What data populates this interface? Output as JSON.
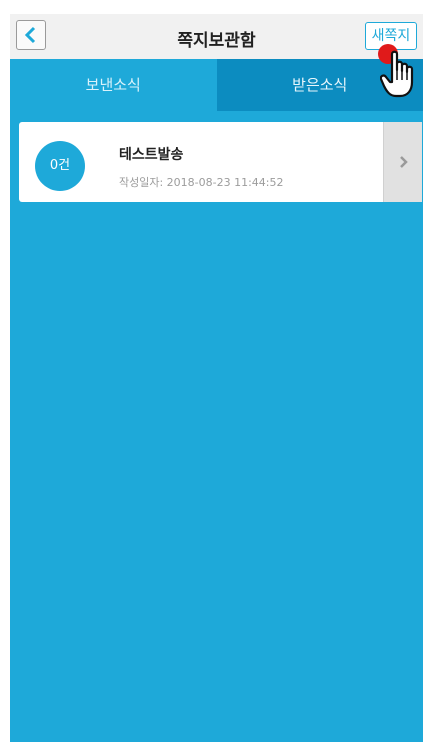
{
  "header": {
    "title": "쪽지보관함",
    "new_message_label": "새쪽지"
  },
  "tabs": [
    {
      "label": "보낸소식",
      "active": true
    },
    {
      "label": "받은소식",
      "active": false
    }
  ],
  "messages": [
    {
      "badge": "0건",
      "title": "테스트발송",
      "date": "작성일자: 2018-08-23 11:44:52"
    }
  ],
  "colors": {
    "accent": "#1ea9d9",
    "inactive_tab": "#0c8cc0",
    "header_bg": "#f1f1f1"
  },
  "icons": [
    "back-arrow-icon",
    "chevron-right-icon",
    "hand-pointer-icon"
  ]
}
